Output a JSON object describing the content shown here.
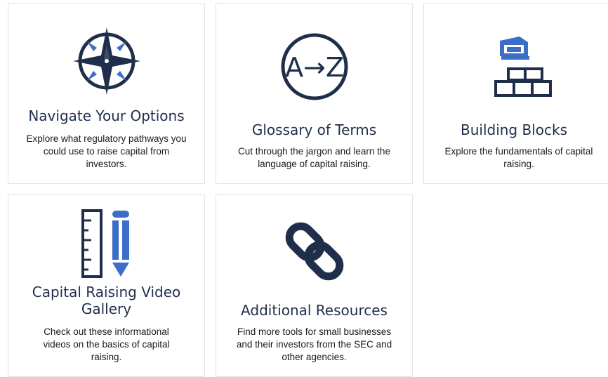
{
  "colors": {
    "navy": "#1f2e4b",
    "blue": "#3a6ec7",
    "card_border": "#e4e4e4"
  },
  "cards": [
    {
      "icon": "compass-icon",
      "title": "Navigate Your Options",
      "description": "Explore what regulatory pathways you could use to raise capital from investors."
    },
    {
      "icon": "a-to-z-glossary-icon",
      "icon_text": "A→Z",
      "title": "Glossary of Terms",
      "description": "Cut through the jargon and learn the language of capital raising."
    },
    {
      "icon": "building-blocks-icon",
      "title": "Building Blocks",
      "description": "Explore the fundamentals of capital raising."
    },
    {
      "icon": "ruler-pencil-icon",
      "title": "Capital Raising Video Gallery",
      "description": "Check out these informational videos on the basics of capital raising."
    },
    {
      "icon": "chain-link-icon",
      "title": "Additional Resources",
      "description": "Find more tools for small businesses and their investors from the SEC and other agencies."
    }
  ]
}
